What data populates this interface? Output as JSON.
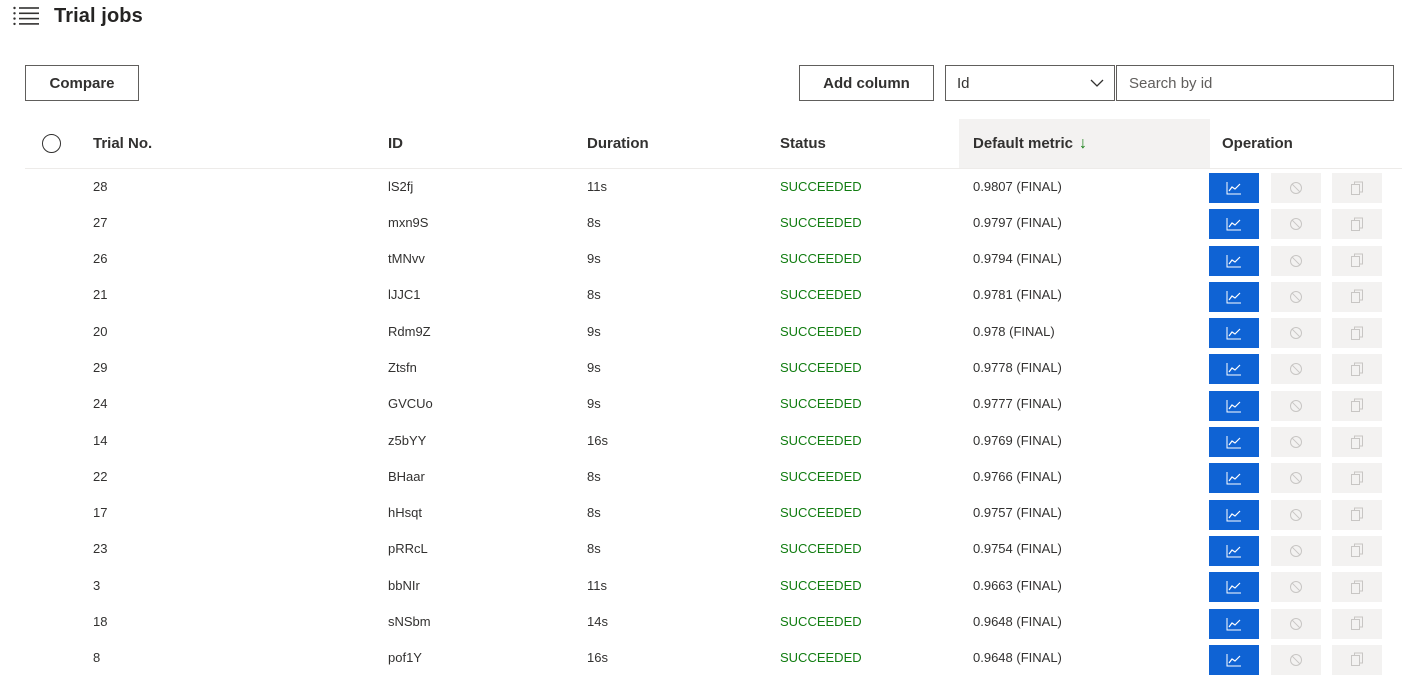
{
  "header": {
    "title": "Trial jobs",
    "icon": "list-icon"
  },
  "toolbar": {
    "compare_label": "Compare",
    "add_column_label": "Add column",
    "filter_select_value": "Id",
    "search_placeholder": "Search by id"
  },
  "table": {
    "columns": {
      "trial_no": "Trial No.",
      "id": "ID",
      "duration": "Duration",
      "status": "Status",
      "metric": "Default metric",
      "metric_sort": "↓",
      "operation": "Operation"
    },
    "rows": [
      {
        "trial": "28",
        "id": "lS2fj",
        "duration": "11s",
        "status": "SUCCEEDED",
        "metric": "0.9807 (FINAL)"
      },
      {
        "trial": "27",
        "id": "mxn9S",
        "duration": "8s",
        "status": "SUCCEEDED",
        "metric": "0.9797 (FINAL)"
      },
      {
        "trial": "26",
        "id": "tMNvv",
        "duration": "9s",
        "status": "SUCCEEDED",
        "metric": "0.9794 (FINAL)"
      },
      {
        "trial": "21",
        "id": "lJJC1",
        "duration": "8s",
        "status": "SUCCEEDED",
        "metric": "0.9781 (FINAL)"
      },
      {
        "trial": "20",
        "id": "Rdm9Z",
        "duration": "9s",
        "status": "SUCCEEDED",
        "metric": "0.978 (FINAL)"
      },
      {
        "trial": "29",
        "id": "Ztsfn",
        "duration": "9s",
        "status": "SUCCEEDED",
        "metric": "0.9778 (FINAL)"
      },
      {
        "trial": "24",
        "id": "GVCUo",
        "duration": "9s",
        "status": "SUCCEEDED",
        "metric": "0.9777 (FINAL)"
      },
      {
        "trial": "14",
        "id": "z5bYY",
        "duration": "16s",
        "status": "SUCCEEDED",
        "metric": "0.9769 (FINAL)"
      },
      {
        "trial": "22",
        "id": "BHaar",
        "duration": "8s",
        "status": "SUCCEEDED",
        "metric": "0.9766 (FINAL)"
      },
      {
        "trial": "17",
        "id": "hHsqt",
        "duration": "8s",
        "status": "SUCCEEDED",
        "metric": "0.9757 (FINAL)"
      },
      {
        "trial": "23",
        "id": "pRRcL",
        "duration": "8s",
        "status": "SUCCEEDED",
        "metric": "0.9754 (FINAL)"
      },
      {
        "trial": "3",
        "id": "bbNIr",
        "duration": "11s",
        "status": "SUCCEEDED",
        "metric": "0.9663 (FINAL)"
      },
      {
        "trial": "18",
        "id": "sNSbm",
        "duration": "14s",
        "status": "SUCCEEDED",
        "metric": "0.9648 (FINAL)"
      },
      {
        "trial": "8",
        "id": "pof1Y",
        "duration": "16s",
        "status": "SUCCEEDED",
        "metric": "0.9648 (FINAL)"
      }
    ],
    "operation_icons": [
      "chart-line-icon",
      "cancel-icon",
      "copy-icon"
    ]
  },
  "colors": {
    "accent": "#0f63d4",
    "success": "#107c10",
    "disabled_bg": "#f3f2f1",
    "sorted_header_bg": "#f3f2f1"
  }
}
